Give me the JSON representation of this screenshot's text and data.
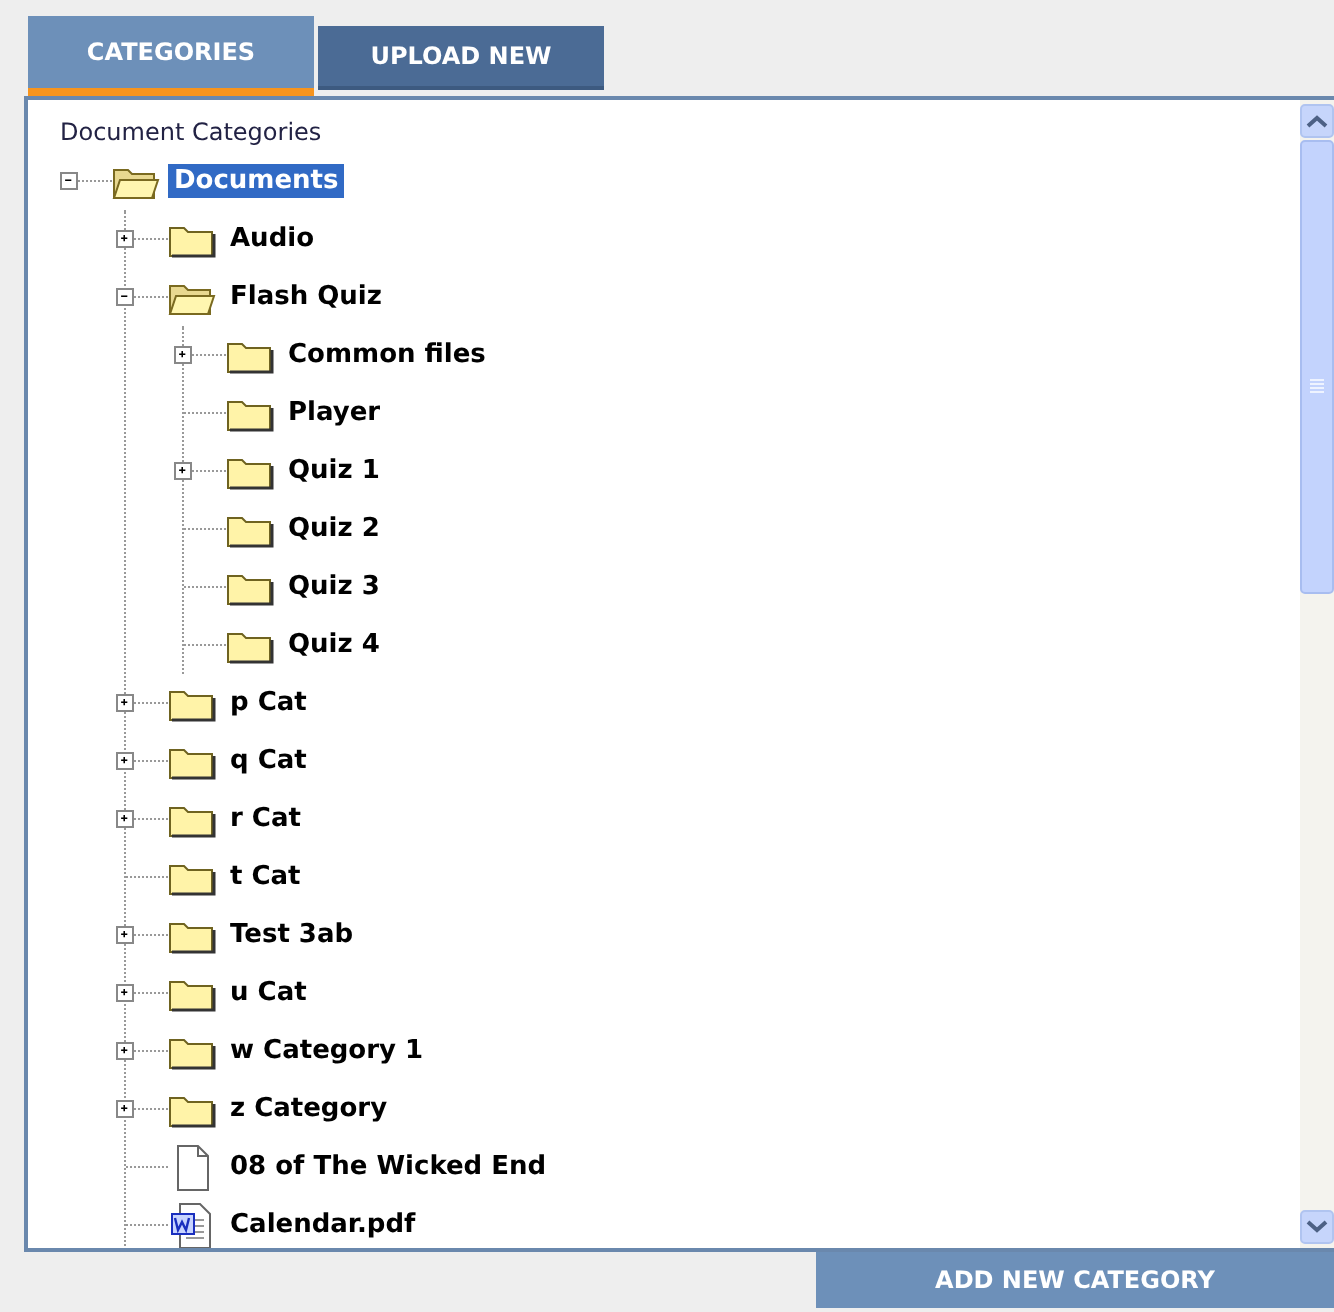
{
  "tabs": [
    {
      "label": "CATEGORIES",
      "selected": true
    },
    {
      "label": "UPLOAD NEW",
      "selected": false
    }
  ],
  "tree": {
    "heading": "Document Categories",
    "root": {
      "label": "Documents",
      "kind": "folder",
      "expanded": true,
      "selected": true,
      "children": [
        {
          "label": "Audio",
          "kind": "folder",
          "expanded": false,
          "selected": false
        },
        {
          "label": "Flash Quiz",
          "kind": "folder",
          "expanded": true,
          "selected": false,
          "children": [
            {
              "label": "Common files",
              "kind": "folder",
              "expanded": false,
              "selected": false
            },
            {
              "label": "Player",
              "kind": "folder",
              "selected": false
            },
            {
              "label": "Quiz 1",
              "kind": "folder",
              "expanded": false,
              "selected": false
            },
            {
              "label": "Quiz 2",
              "kind": "folder",
              "selected": false
            },
            {
              "label": "Quiz 3",
              "kind": "folder",
              "selected": false
            },
            {
              "label": "Quiz 4",
              "kind": "folder",
              "selected": false
            }
          ]
        },
        {
          "label": "p Cat",
          "kind": "folder",
          "expanded": false,
          "selected": false
        },
        {
          "label": "q Cat",
          "kind": "folder",
          "expanded": false,
          "selected": false
        },
        {
          "label": "r Cat",
          "kind": "folder",
          "expanded": false,
          "selected": false
        },
        {
          "label": "t Cat",
          "kind": "folder",
          "selected": false
        },
        {
          "label": "Test 3ab",
          "kind": "folder",
          "expanded": false,
          "selected": false
        },
        {
          "label": "u Cat",
          "kind": "folder",
          "expanded": false,
          "selected": false
        },
        {
          "label": "w Category 1",
          "kind": "folder",
          "expanded": false,
          "selected": false
        },
        {
          "label": "z Category",
          "kind": "folder",
          "expanded": false,
          "selected": false
        },
        {
          "label": "08 of The Wicked End",
          "kind": "file",
          "selected": false
        },
        {
          "label": "Calendar.pdf",
          "kind": "word",
          "selected": false
        }
      ]
    }
  },
  "footer": {
    "button": "ADD NEW CATEGORY"
  }
}
